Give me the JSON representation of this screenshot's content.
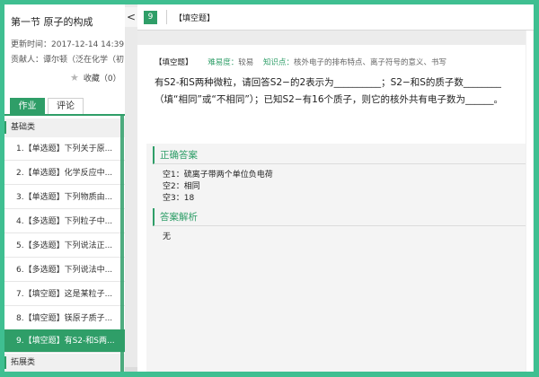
{
  "lesson": {
    "title": "第一节 原子的构成",
    "updated": "更新时间：2017-12-14 14:39",
    "contributor": "贡献人：谭尔顿（泛在化学（初"
  },
  "favorite": {
    "label": "收藏（0）",
    "icon": "star-icon"
  },
  "tabs": [
    {
      "label": "作业",
      "active": true
    },
    {
      "label": "评论",
      "active": false
    }
  ],
  "sections": [
    {
      "label": "基础类"
    },
    {
      "label": "拓展类"
    }
  ],
  "items": [
    {
      "label": "1.【单选题】下列关于原..."
    },
    {
      "label": "2.【单选题】化学反应中..."
    },
    {
      "label": "3.【单选题】下列物质由..."
    },
    {
      "label": "4.【多选题】下列粒子中..."
    },
    {
      "label": "5.【多选题】下列说法正..."
    },
    {
      "label": "6.【多选题】下列说法中..."
    },
    {
      "label": "7.【填空题】这是某粒子..."
    },
    {
      "label": "8.【填空题】镁原子质子..."
    },
    {
      "label": "9.【填空题】有S2-和S两..."
    }
  ],
  "collapse": {
    "icon": "chevron-left-icon",
    "glyph": "<"
  },
  "header": {
    "number": "9",
    "type_label": "【填空题】"
  },
  "info": {
    "tag": "【填空题】",
    "difficulty_key": "难易度：",
    "difficulty_val": "较易",
    "knowledge_key": "知识点：",
    "knowledge_val": "核外电子的排布特点、离子符号的意义、书写"
  },
  "question": {
    "text": "有S2-和S两种微粒，请回答S2−的2表示为__________；S2−和S的质子数________（填“相同”或“不相同”）；已知S2−有16个质子，则它的核外共有电子数为______。"
  },
  "answer": {
    "head": "正确答案",
    "lines": [
      "空1：硫离子带两个单位负电荷",
      "空2：相同",
      "空3：18"
    ],
    "analysis_head": "答案解析",
    "analysis": "无"
  },
  "colors": {
    "accent": "#2f9e68",
    "border_outer": "#3fbf91"
  }
}
